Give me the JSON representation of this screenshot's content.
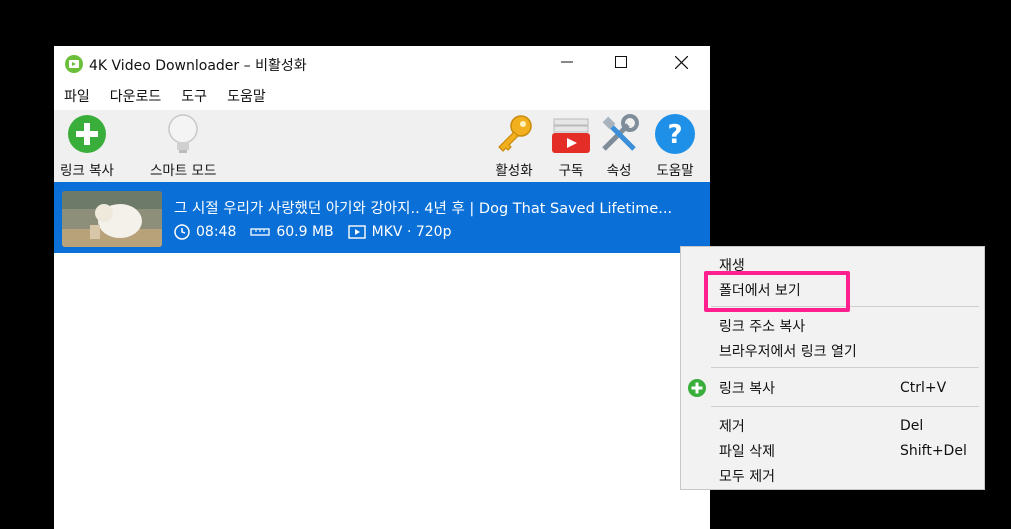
{
  "window": {
    "title": "4K Video Downloader – 비활성화",
    "controls": {
      "minimize": "minimize-icon",
      "maximize": "maximize-icon",
      "close": "close-icon"
    }
  },
  "menubar": {
    "items": [
      "파일",
      "다운로드",
      "도구",
      "도움말"
    ]
  },
  "toolbar": {
    "paste_link": "링크 복사",
    "smart_mode": "스마트 모드",
    "activate": "활성화",
    "subscribe": "구독",
    "preferences": "속성",
    "help": "도움말"
  },
  "download_item": {
    "title": "그 시절 우리가 사랑했던 아기와 강아지.. 4년 후 | Dog That Saved Lifetime...",
    "duration": "08:48",
    "size": "60.9 MB",
    "format": "MKV · 720p"
  },
  "context_menu": {
    "play": "재생",
    "show_in_folder": "폴더에서 보기",
    "copy_link_address": "링크 주소 복사",
    "open_link_in_browser": "브라우저에서 링크 열기",
    "paste_link": "링크 복사",
    "paste_link_shortcut": "Ctrl+V",
    "remove": "제거",
    "remove_shortcut": "Del",
    "delete_file": "파일 삭제",
    "delete_file_shortcut": "Shift+Del",
    "remove_all": "모두 제거"
  },
  "colors": {
    "selection": "#0a6fd6",
    "highlight_box": "#ff1f8e",
    "green": "#3aae3a",
    "help_blue": "#1e90e8"
  }
}
